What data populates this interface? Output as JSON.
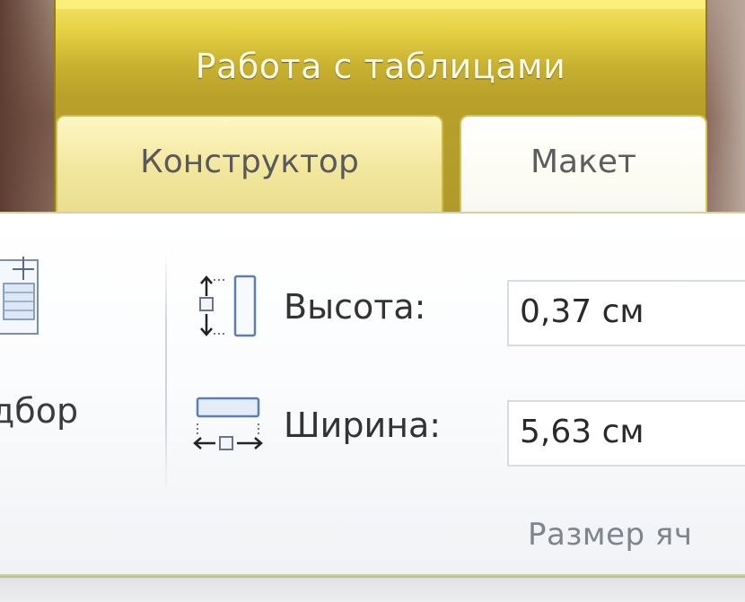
{
  "context_group": {
    "title": "Работа с таблицами",
    "color": "#e9d548"
  },
  "tabs": [
    {
      "label": "Конструктор",
      "active": false
    },
    {
      "label": "Макет",
      "active": true
    }
  ],
  "autofit": {
    "label": "дбор",
    "icon": "table-autofit-icon"
  },
  "cell_size": {
    "height": {
      "label": "Высота:",
      "value": "0,37 см",
      "icon": "row-height-icon"
    },
    "width": {
      "label": "Ширина:",
      "value": "5,63 см",
      "icon": "column-width-icon"
    },
    "group_label": "Размер яч"
  },
  "colors": {
    "accent_tab_border": "#cdbb4d",
    "ribbon_background": "#ffffff",
    "group_label_text": "#7f858c"
  }
}
